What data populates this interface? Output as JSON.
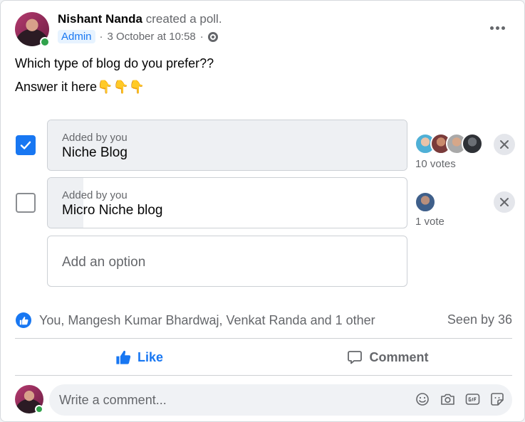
{
  "post": {
    "author": "Nishant Nanda",
    "action": "created a poll.",
    "badge": "Admin",
    "timestamp": "3 October at 10:58",
    "separator": "·",
    "audience_icon": "globe-icon",
    "text_line1": "Which type of blog do you prefer??",
    "text_line2": "Answer it here",
    "text_line2_emoji": "👇👇👇"
  },
  "poll": {
    "options": [
      {
        "added_by": "Added by you",
        "label": "Niche Blog",
        "checked": true,
        "votes_label": "10 votes",
        "fill_fraction": 1.0
      },
      {
        "added_by": "Added by you",
        "label": "Micro Niche blog",
        "checked": false,
        "votes_label": "1 vote",
        "fill_fraction": 0.1
      }
    ],
    "add_option_placeholder": "Add an option"
  },
  "reactions": {
    "summary": "You, Mangesh Kumar Bhardwaj, Venkat Randa and 1 other",
    "seen": "Seen by 36"
  },
  "actions": {
    "like": "Like",
    "comment": "Comment"
  },
  "composer": {
    "placeholder": "Write a comment..."
  },
  "colors": {
    "accent": "#1877f2",
    "online": "#31a24c",
    "secondary_text": "#65676b"
  }
}
